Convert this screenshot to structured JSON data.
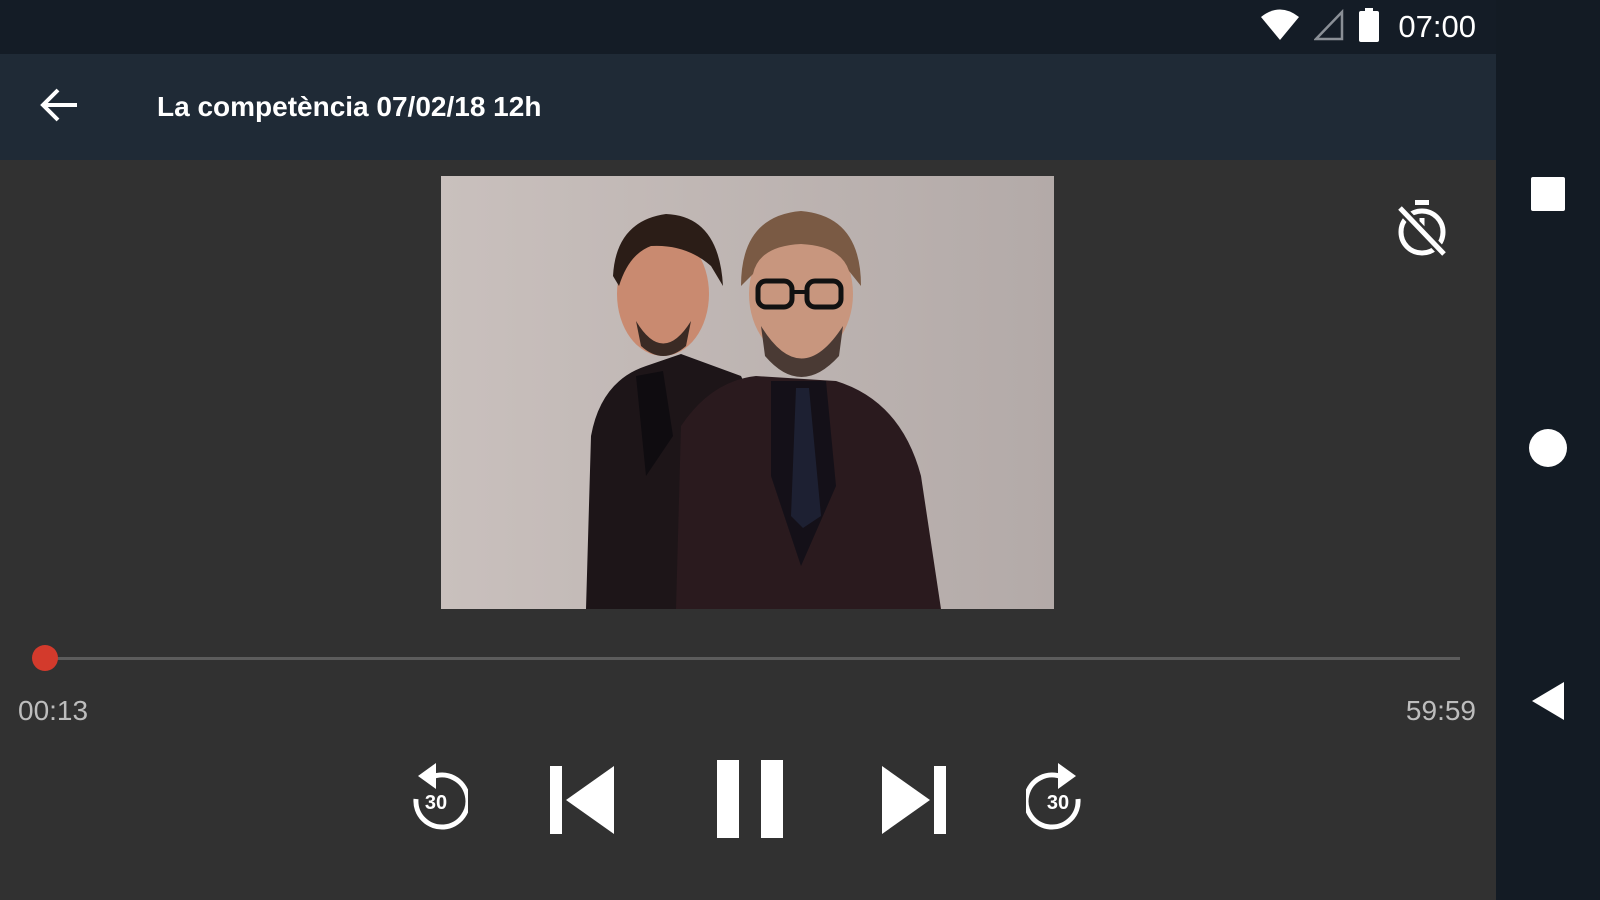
{
  "status_bar": {
    "time": "07:00",
    "icons": [
      "wifi-icon",
      "cell-signal-icon",
      "battery-icon"
    ]
  },
  "app_bar": {
    "back_icon": "arrow-left-icon",
    "title": "La competència 07/02/18 12h"
  },
  "player": {
    "artwork_alt": "",
    "sleep_timer_icon": "timer-off-icon",
    "progress": {
      "elapsed": "00:13",
      "total": "59:59",
      "fraction": 0.0036
    },
    "controls": {
      "replay_icon": "replay-30-icon",
      "replay_label": "30",
      "previous_icon": "skip-previous-icon",
      "pause_icon": "pause-icon",
      "next_icon": "skip-next-icon",
      "forward_icon": "forward-30-icon",
      "forward_label": "30"
    }
  },
  "navigation_bar": {
    "icons": [
      "recents-square-icon",
      "home-circle-icon",
      "back-triangle-icon"
    ]
  },
  "colors": {
    "accent": "#d33a2c",
    "status_bar": "#141c26",
    "app_bar": "#1f2a36",
    "background": "#313131",
    "nav_bar": "#131b24"
  }
}
